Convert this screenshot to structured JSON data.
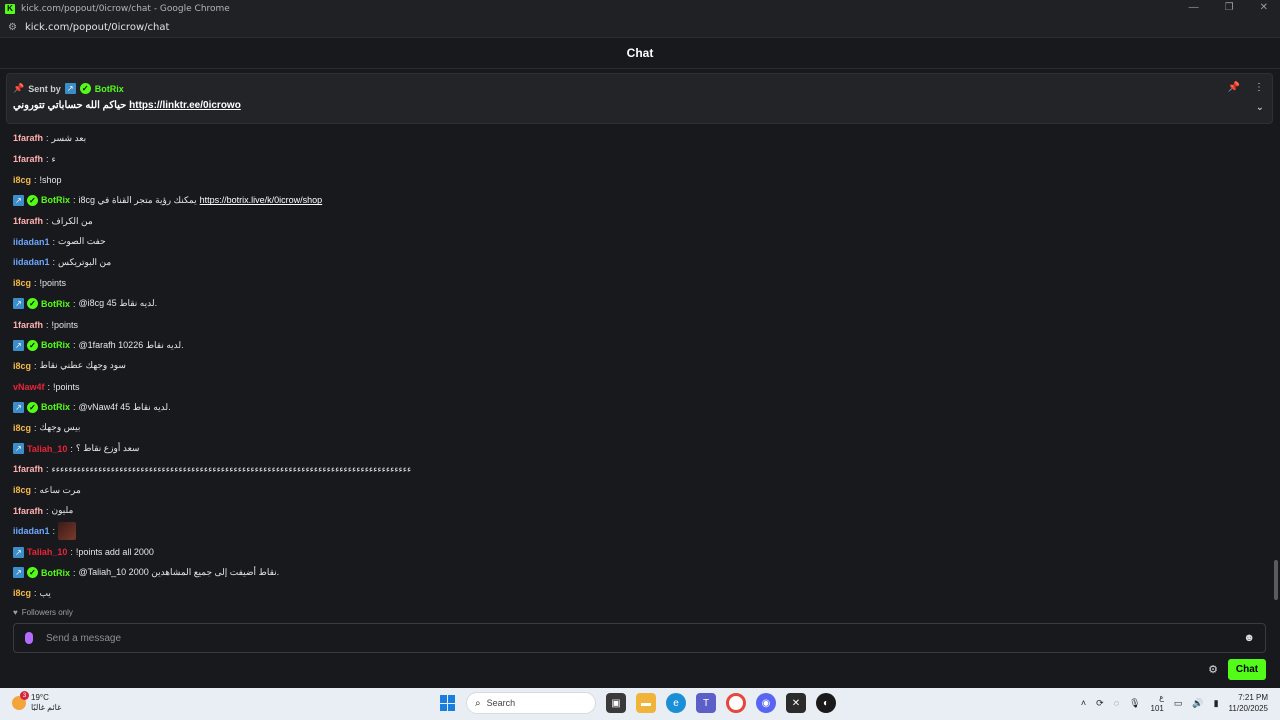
{
  "window": {
    "title": "kick.com/popout/0icrow/chat - Google Chrome",
    "url": "kick.com/popout/0icrow/chat"
  },
  "header": {
    "title": "Chat"
  },
  "pinned": {
    "sent_by_label": "Sent by",
    "sender": "BotRix",
    "text": "حياكم الله حساباتي تتوروني",
    "link": "https://linktr.ee/0icrowo"
  },
  "messages": [
    {
      "user": "1farafh",
      "color": "#ffb0b0",
      "text": "بعد شسر",
      "bot": false
    },
    {
      "user": "1farafh",
      "color": "#ffb0b0",
      "text": "ء",
      "bot": false
    },
    {
      "user": "i8cg",
      "color": "#f5b94b",
      "text": "!shop",
      "bot": false
    },
    {
      "user": "BotRix",
      "color": "#53fc18",
      "text": "i8cg يمكنك رؤية متجر القناة في",
      "link": "https://botrix.live/k/0icrow/shop",
      "bot": true
    },
    {
      "user": "1farafh",
      "color": "#ffb0b0",
      "text": "من الكراف",
      "bot": false
    },
    {
      "user": "iidadan1",
      "color": "#6fa6ff",
      "text": "حفت الصوت",
      "bot": false
    },
    {
      "user": "iidadan1",
      "color": "#6fa6ff",
      "text": "من البوتريكس",
      "bot": false
    },
    {
      "user": "i8cg",
      "color": "#f5b94b",
      "text": "!points",
      "bot": false
    },
    {
      "user": "BotRix",
      "color": "#53fc18",
      "text": "@i8cg 45 لديه نقاط.",
      "bot": true
    },
    {
      "user": "1farafh",
      "color": "#ffb0b0",
      "text": "!points",
      "bot": false
    },
    {
      "user": "BotRix",
      "color": "#53fc18",
      "text": "@1farafh 10226 لديه نقاط.",
      "bot": true
    },
    {
      "user": "i8cg",
      "color": "#f5b94b",
      "text": "سود وجهك عطني نقاط",
      "bot": false
    },
    {
      "user": "vNaw4f",
      "color": "#e8243a",
      "text": "!points",
      "bot": false
    },
    {
      "user": "BotRix",
      "color": "#53fc18",
      "text": "@vNaw4f 45 لديه نقاط.",
      "bot": true
    },
    {
      "user": "i8cg",
      "color": "#f5b94b",
      "text": "بيس وجهك",
      "bot": false
    },
    {
      "user": "Taliah_10",
      "color": "#e8243a",
      "text": "سعد أوزع نقاط ؟",
      "bot": false,
      "mod": true
    },
    {
      "user": "1farafh",
      "color": "#ffb0b0",
      "text": "ءءءءءءءءءءءءءءءءءءءءءءءءءءءءءءءءءءءءءءءءءءءءءءءءءءءءءءءءءءءءءءءءءءءءءءءءءءءءءءءءءءءءء",
      "bot": false
    },
    {
      "user": "i8cg",
      "color": "#f5b94b",
      "text": "مرت ساعه",
      "bot": false
    },
    {
      "user": "1farafh",
      "color": "#ffb0b0",
      "text": "مليون",
      "bot": false
    },
    {
      "user": "iidadan1",
      "color": "#6fa6ff",
      "text": "",
      "emote": true,
      "bot": false
    },
    {
      "user": "Taliah_10",
      "color": "#e8243a",
      "text": "!points add all 2000",
      "bot": false,
      "mod": true
    },
    {
      "user": "BotRix",
      "color": "#53fc18",
      "text": "@Taliah_10 2000 نقاط أضيفت إلى جميع المشاهدين.",
      "bot": true
    },
    {
      "user": "i8cg",
      "color": "#f5b94b",
      "text": "يب",
      "bot": false
    }
  ],
  "followers_only": "Followers only",
  "composer": {
    "placeholder": "Send a message"
  },
  "chat_button": "Chat",
  "taskbar": {
    "weather_temp": "19°C",
    "weather_desc": "غائم غالبًا",
    "weather_badge": "3",
    "search_label": "Search",
    "lang": "ع",
    "lang2": "101",
    "time": "7:21 PM",
    "date": "11/20/2025"
  }
}
